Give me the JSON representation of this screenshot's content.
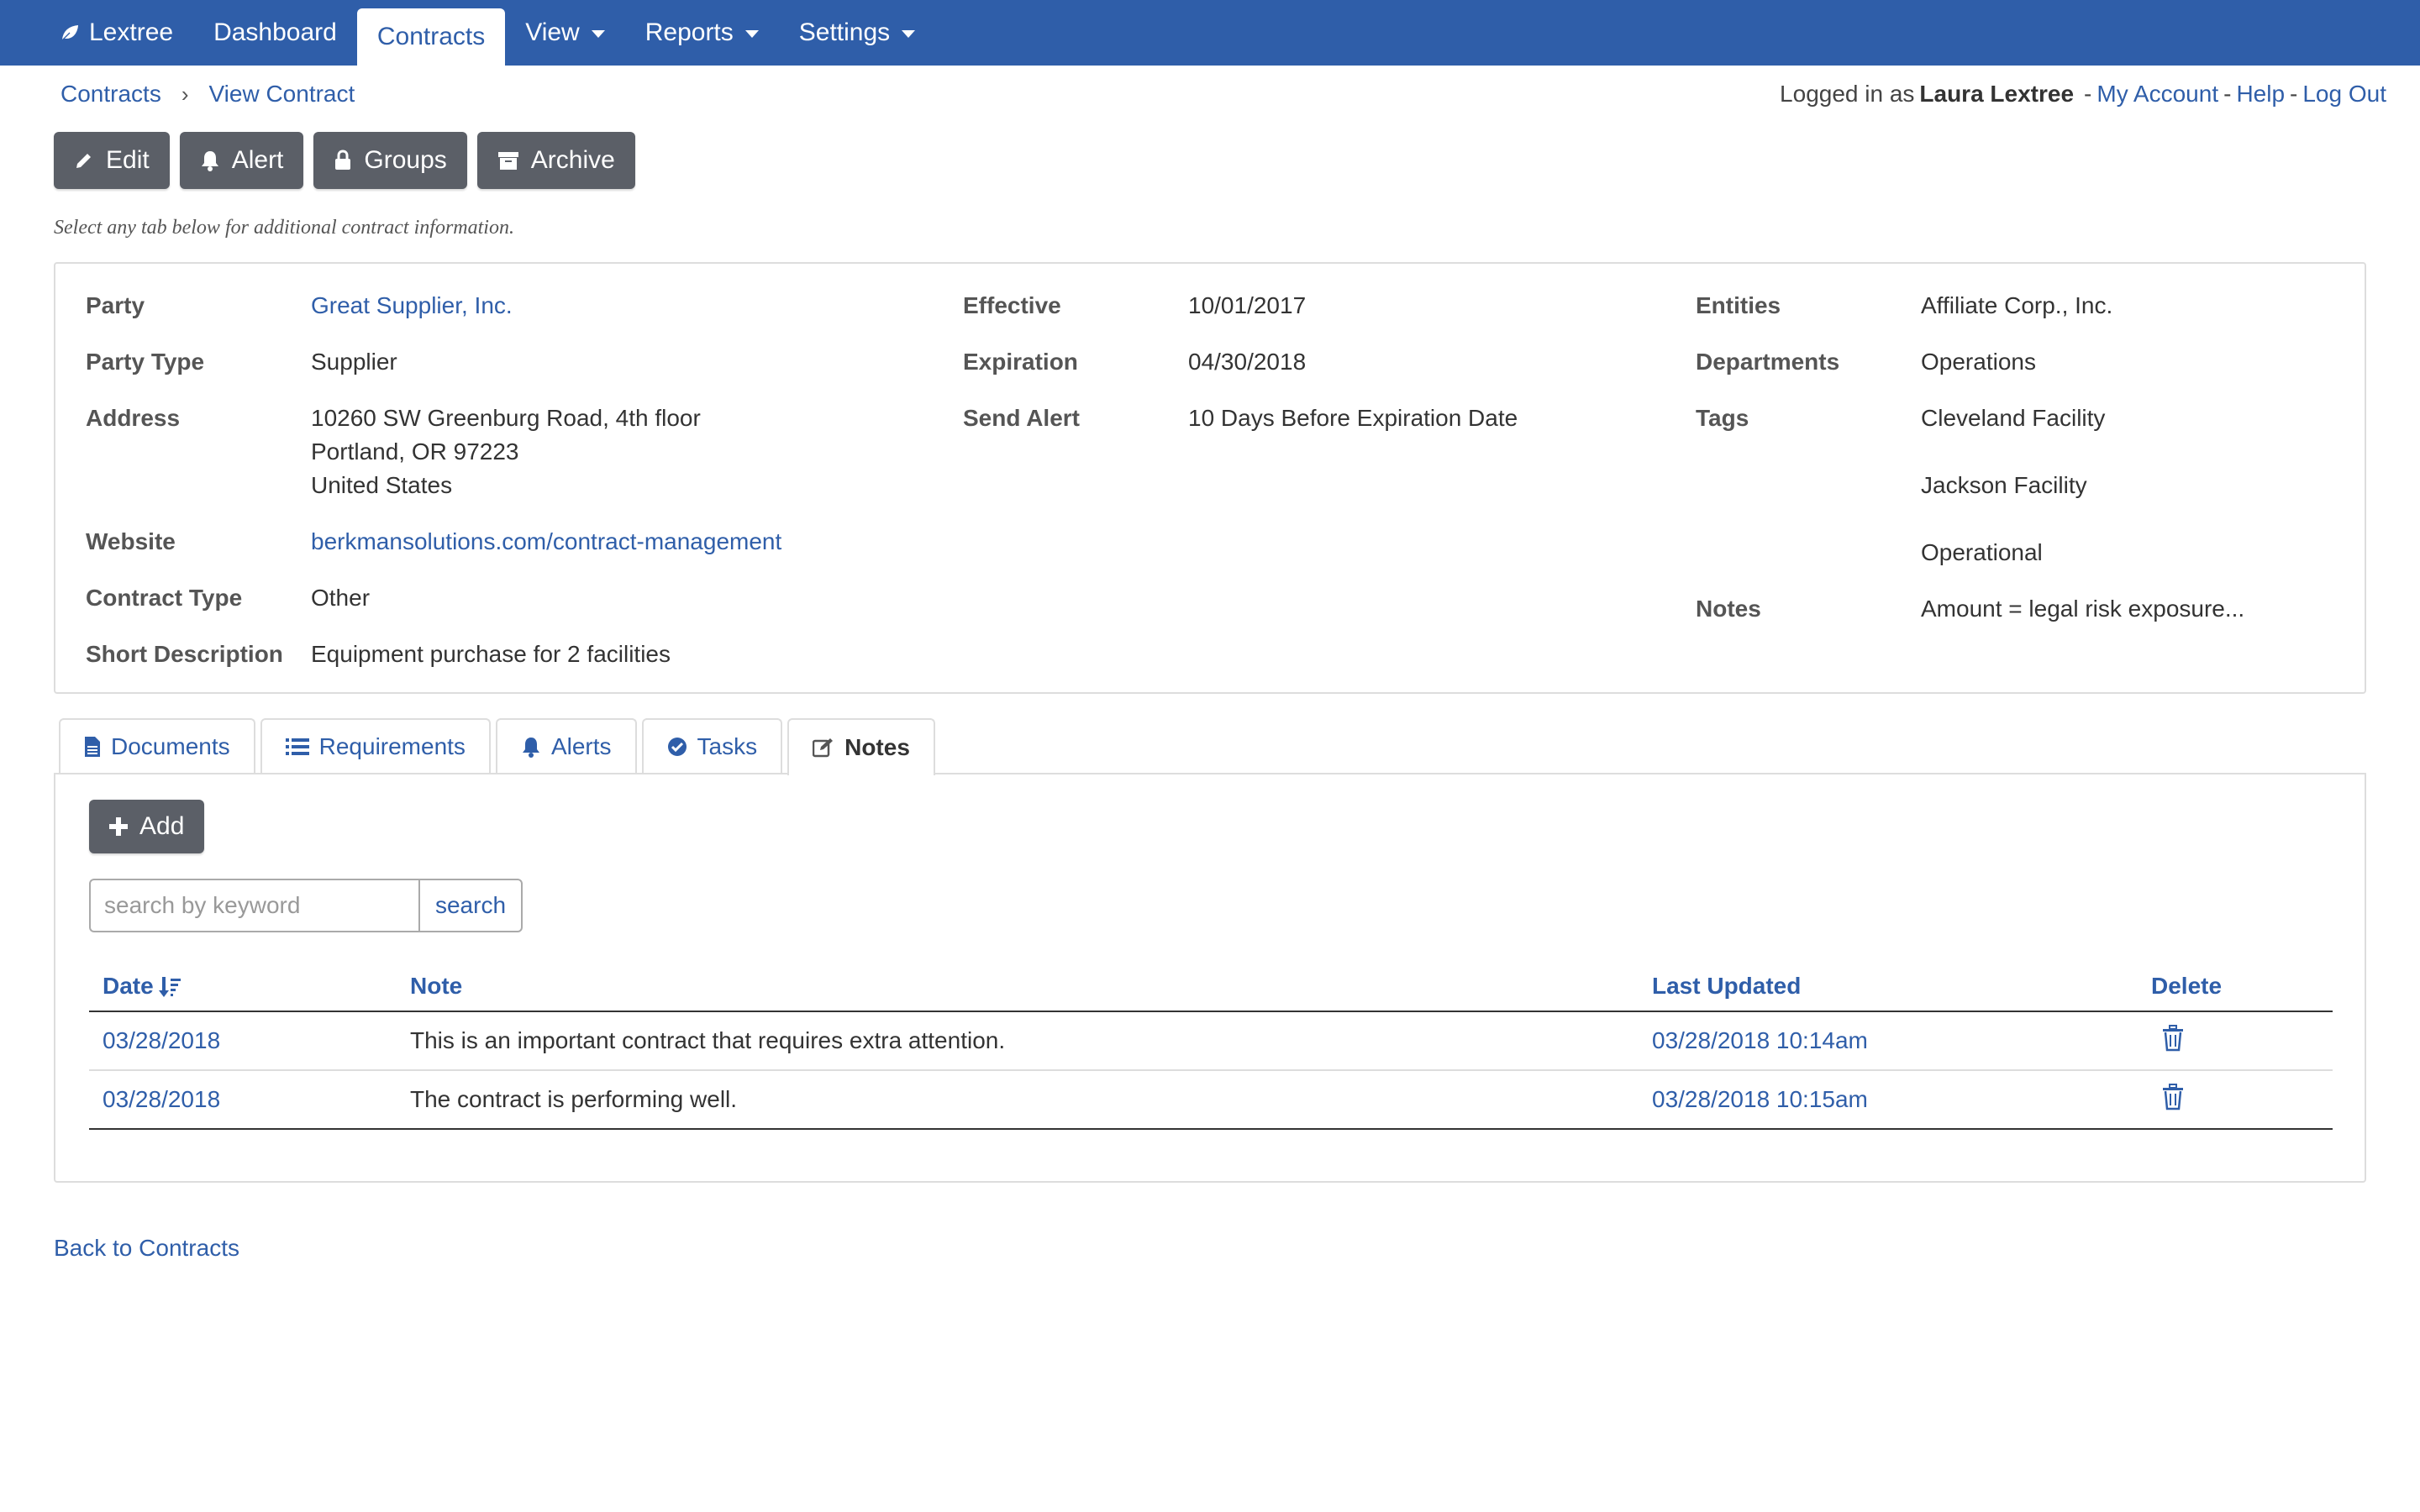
{
  "nav": {
    "brand": "Lextree",
    "items": [
      {
        "label": "Dashboard",
        "dropdown": false,
        "active": false
      },
      {
        "label": "Contracts",
        "dropdown": false,
        "active": true
      },
      {
        "label": "View",
        "dropdown": true,
        "active": false
      },
      {
        "label": "Reports",
        "dropdown": true,
        "active": false
      },
      {
        "label": "Settings",
        "dropdown": true,
        "active": false
      }
    ]
  },
  "breadcrumb": {
    "root": "Contracts",
    "current": "View Contract"
  },
  "account": {
    "prefix": "Logged in as",
    "user": "Laura Lextree",
    "my_account": "My Account",
    "help": "Help",
    "logout": "Log Out"
  },
  "actions": {
    "edit": "Edit",
    "alert": "Alert",
    "groups": "Groups",
    "archive": "Archive"
  },
  "hint": "Select any tab below for additional contract information.",
  "contract": {
    "col1": {
      "party_label": "Party",
      "party": "Great Supplier, Inc.",
      "party_type_label": "Party Type",
      "party_type": "Supplier",
      "address_label": "Address",
      "address_line1": "10260 SW Greenburg Road, 4th floor",
      "address_line2": "Portland, OR 97223",
      "address_line3": "United States",
      "website_label": "Website",
      "website": "berkmansolutions.com/contract-management",
      "contract_type_label": "Contract Type",
      "contract_type": "Other",
      "short_desc_label": "Short Description",
      "short_desc": "Equipment purchase for 2 facilities"
    },
    "col2": {
      "effective_label": "Effective",
      "effective": "10/01/2017",
      "expiration_label": "Expiration",
      "expiration": "04/30/2018",
      "send_alert_label": "Send Alert",
      "send_alert": "10 Days Before Expiration Date"
    },
    "col3": {
      "entities_label": "Entities",
      "entities": "Affiliate Corp., Inc.",
      "departments_label": "Departments",
      "departments": "Operations",
      "tags_label": "Tags",
      "tags": [
        "Cleveland Facility",
        "Jackson Facility",
        "Operational"
      ],
      "notes_label": "Notes",
      "notes": "Amount = legal risk exposure..."
    }
  },
  "tabs": {
    "documents": "Documents",
    "requirements": "Requirements",
    "alerts": "Alerts",
    "tasks": "Tasks",
    "notes": "Notes"
  },
  "notes_panel": {
    "add_label": "Add",
    "search_placeholder": "search by keyword",
    "search_label": "search",
    "columns": {
      "date": "Date",
      "note": "Note",
      "last_updated": "Last Updated",
      "delete": "Delete"
    },
    "rows": [
      {
        "date": "03/28/2018",
        "note": "This is an important contract that requires extra attention.",
        "last_updated": "03/28/2018 10:14am"
      },
      {
        "date": "03/28/2018",
        "note": "The contract is performing well.",
        "last_updated": "03/28/2018 10:15am"
      }
    ]
  },
  "back_link": "Back to Contracts",
  "colors": {
    "brand": "#2f5ea9",
    "button": "#5b5f67"
  }
}
